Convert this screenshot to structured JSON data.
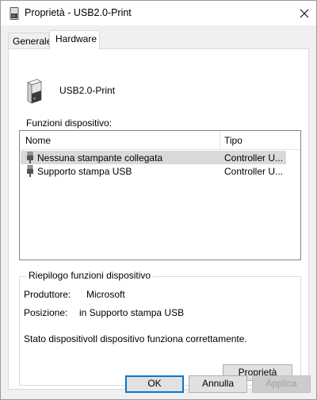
{
  "window": {
    "title": "Proprietà - USB2.0-Print"
  },
  "tabs": [
    {
      "label": "Generale"
    },
    {
      "label": "Hardware"
    }
  ],
  "device": {
    "name": "USB2.0-Print"
  },
  "functions": {
    "label": "Funzioni dispositivo:",
    "columns": {
      "name": "Nome",
      "type": "Tipo"
    },
    "rows": [
      {
        "name": "Nessuna stampante collegata",
        "type": "Controller U..."
      },
      {
        "name": "Supporto stampa USB",
        "type": "Controller U..."
      }
    ]
  },
  "summary": {
    "title": "Riepilogo funzioni dispositivo",
    "manufacturer_label": "Produttore:",
    "manufacturer_value": "Microsoft",
    "location_label": "Posizione:",
    "location_value": "in Supporto stampa USB",
    "status_label": "Stato dispositivo:",
    "status_value": "Il dispositivo funziona correttamente.",
    "properties_button": "Proprietà"
  },
  "buttons": {
    "ok": "OK",
    "cancel": "Annulla",
    "apply": "Applica"
  },
  "colors": {
    "accent": "#0078d7",
    "selection": "#d9d9d9"
  },
  "icons": [
    "device-icon",
    "close-icon",
    "usb-plug-icon"
  ]
}
